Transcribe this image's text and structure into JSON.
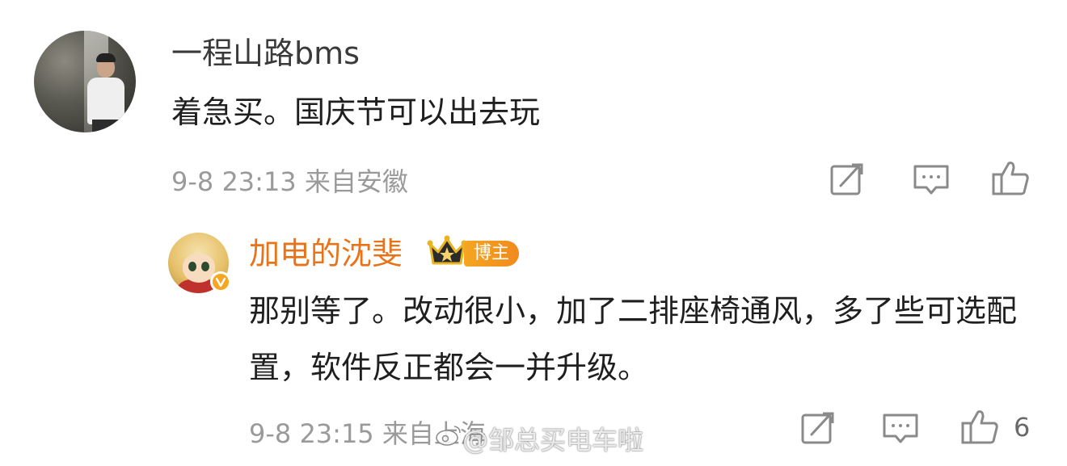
{
  "comments": [
    {
      "username": "一程山路bms",
      "text": "着急买。国庆节可以出去玩",
      "meta": "9-8 23:13  来自安徽"
    },
    {
      "username": "加电的沈斐",
      "badge": "博主",
      "text": "那别等了。改动很小，加了二排座椅通风，多了些可选配置，软件反正都会一并升级。",
      "meta": "9-8 23:15  来自上海",
      "like_count": "6"
    }
  ],
  "watermark": "@邹总买电车啦",
  "colors": {
    "author_orange": "#e8741a",
    "meta_gray": "#9a9a9a",
    "badge_gold": "#f5a623"
  },
  "icons": {
    "repost": "repost-icon",
    "comment": "comment-icon",
    "like": "like-icon",
    "crown": "crown-icon",
    "verified": "verified-icon",
    "weibo": "weibo-logo-icon"
  }
}
